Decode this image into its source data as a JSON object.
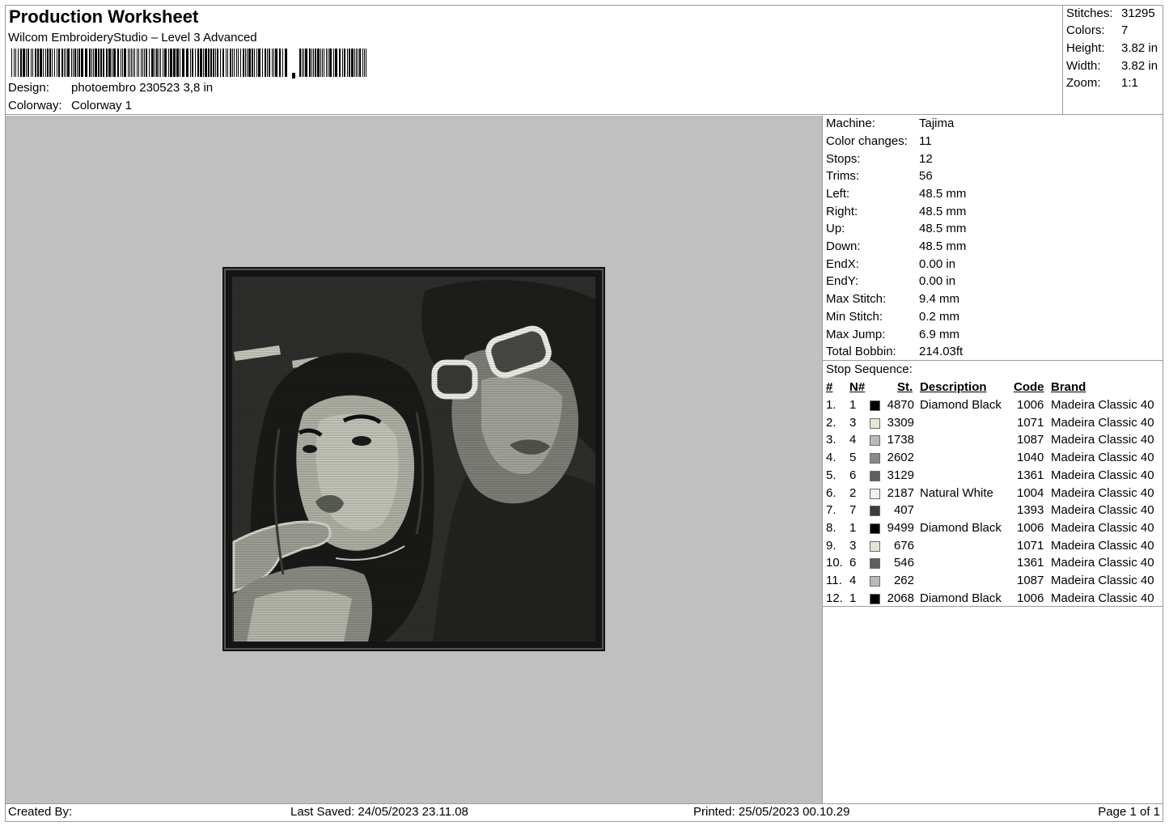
{
  "header": {
    "title": "Production Worksheet",
    "software": "Wilcom EmbroideryStudio – Level 3 Advanced",
    "design_label": "Design:",
    "design_value": "photoembro 230523 3,8 in",
    "colorway_label": "Colorway:",
    "colorway_value": "Colorway 1"
  },
  "summary": [
    {
      "label": "Stitches:",
      "value": "31295"
    },
    {
      "label": "Colors:",
      "value": "7"
    },
    {
      "label": "Height:",
      "value": "3.82 in"
    },
    {
      "label": "Width:",
      "value": "3.82 in"
    },
    {
      "label": "Zoom:",
      "value": "1:1"
    }
  ],
  "machine_info": [
    {
      "label": "Machine:",
      "value": "Tajima"
    },
    {
      "label": "Color changes:",
      "value": "11"
    },
    {
      "label": "Stops:",
      "value": "12"
    },
    {
      "label": "Trims:",
      "value": "56"
    },
    {
      "label": "Left:",
      "value": "48.5 mm"
    },
    {
      "label": "Right:",
      "value": "48.5 mm"
    },
    {
      "label": "Up:",
      "value": "48.5 mm"
    },
    {
      "label": "Down:",
      "value": "48.5 mm"
    },
    {
      "label": "EndX:",
      "value": "0.00 in"
    },
    {
      "label": "EndY:",
      "value": "0.00 in"
    },
    {
      "label": "Max Stitch:",
      "value": "9.4 mm"
    },
    {
      "label": "Min Stitch:",
      "value": "0.2 mm"
    },
    {
      "label": "Max Jump:",
      "value": "6.9 mm"
    },
    {
      "label": "Total Bobbin:",
      "value": "214.03ft"
    }
  ],
  "stop_sequence": {
    "title": "Stop Sequence:",
    "columns": {
      "num": "#",
      "needle": "N#",
      "stitches": "St.",
      "description": "Description",
      "code": "Code",
      "brand": "Brand"
    },
    "rows": [
      {
        "num": "1.",
        "needle": "1",
        "color": "#000000",
        "stitches": "4870",
        "description": "Diamond Black",
        "code": "1006",
        "brand": "Madeira Classic 40"
      },
      {
        "num": "2.",
        "needle": "3",
        "color": "#e8e4da",
        "stitches": "3309",
        "description": "",
        "code": "1071",
        "brand": "Madeira Classic 40"
      },
      {
        "num": "3.",
        "needle": "4",
        "color": "#b9b9b5",
        "stitches": "1738",
        "description": "",
        "code": "1087",
        "brand": "Madeira Classic 40"
      },
      {
        "num": "4.",
        "needle": "5",
        "color": "#8a8a88",
        "stitches": "2602",
        "description": "",
        "code": "1040",
        "brand": "Madeira Classic 40"
      },
      {
        "num": "5.",
        "needle": "6",
        "color": "#5f5f5d",
        "stitches": "3129",
        "description": "",
        "code": "1361",
        "brand": "Madeira Classic 40"
      },
      {
        "num": "6.",
        "needle": "2",
        "color": "#eef0f6",
        "stitches": "2187",
        "description": "Natural White",
        "code": "1004",
        "brand": "Madeira Classic 40"
      },
      {
        "num": "7.",
        "needle": "7",
        "color": "#3b3d37",
        "stitches": "407",
        "description": "",
        "code": "1393",
        "brand": "Madeira Classic 40"
      },
      {
        "num": "8.",
        "needle": "1",
        "color": "#000000",
        "stitches": "9499",
        "description": "Diamond Black",
        "code": "1006",
        "brand": "Madeira Classic 40"
      },
      {
        "num": "9.",
        "needle": "3",
        "color": "#e8e4da",
        "stitches": "676",
        "description": "",
        "code": "1071",
        "brand": "Madeira Classic 40"
      },
      {
        "num": "10.",
        "needle": "6",
        "color": "#5f5f5d",
        "stitches": "546",
        "description": "",
        "code": "1361",
        "brand": "Madeira Classic 40"
      },
      {
        "num": "11.",
        "needle": "4",
        "color": "#b9b9b5",
        "stitches": "262",
        "description": "",
        "code": "1087",
        "brand": "Madeira Classic 40"
      },
      {
        "num": "12.",
        "needle": "1",
        "color": "#000000",
        "stitches": "2068",
        "description": "Diamond Black",
        "code": "1006",
        "brand": "Madeira Classic 40"
      }
    ]
  },
  "footer": {
    "created_by": "Created By:",
    "last_saved": "Last Saved: 24/05/2023 23.11.08",
    "printed": "Printed: 25/05/2023 00.10.29",
    "page": "Page 1 of 1"
  }
}
